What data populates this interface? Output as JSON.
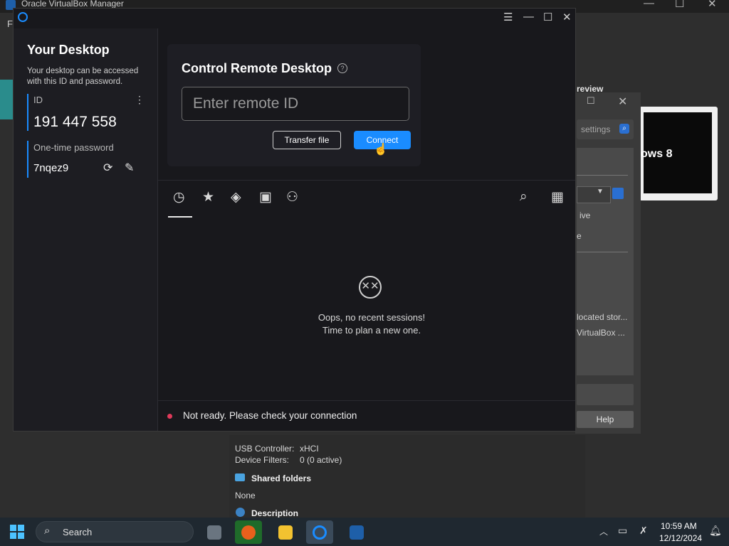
{
  "vbox": {
    "title": "Oracle VirtualBox Manager",
    "menu_first": "F",
    "preview_label": "review",
    "preview_os": "ows 8",
    "details": {
      "usb_controller_label": "USB Controller:",
      "usb_controller_value": "xHCI",
      "device_filters_label": "Device Filters:",
      "device_filters_value": "0 (0 active)",
      "shared_folders_heading": "Shared folders",
      "shared_folders_value": "None",
      "description_heading": "Description"
    },
    "settings": {
      "search_placeholder": "settings",
      "text_ive": "ive",
      "text_e": "e",
      "text_located": "located stor...",
      "text_virtualbox": "VirtualBox ...",
      "help_label": "Help"
    }
  },
  "rustdesk": {
    "left": {
      "title": "Your Desktop",
      "description": "Your desktop can be accessed with this ID and password.",
      "id_label": "ID",
      "id_value": "191 447 558",
      "password_label": "One-time password",
      "password_value": "7nqez9"
    },
    "control": {
      "title": "Control Remote Desktop",
      "input_placeholder": "Enter remote ID",
      "input_value": "",
      "transfer_label": "Transfer file",
      "connect_label": "Connect"
    },
    "tabs": [
      {
        "name": "recent",
        "icon": "clock-icon",
        "active": true
      },
      {
        "name": "favorites",
        "icon": "star-icon",
        "active": false
      },
      {
        "name": "discovered",
        "icon": "compass-icon",
        "active": false
      },
      {
        "name": "address-book",
        "icon": "contact-book-icon",
        "active": false
      },
      {
        "name": "group",
        "icon": "people-icon",
        "active": false
      }
    ],
    "empty": {
      "line1": "Oops, no recent sessions!",
      "line2": "Time to plan a new one."
    },
    "status": {
      "text": "Not ready. Please check your connection",
      "color": "#e03a5a"
    },
    "accent": "#1a8cff"
  },
  "taskbar": {
    "search_label": "Search",
    "time": "10:59 AM",
    "date": "12/12/2024"
  }
}
